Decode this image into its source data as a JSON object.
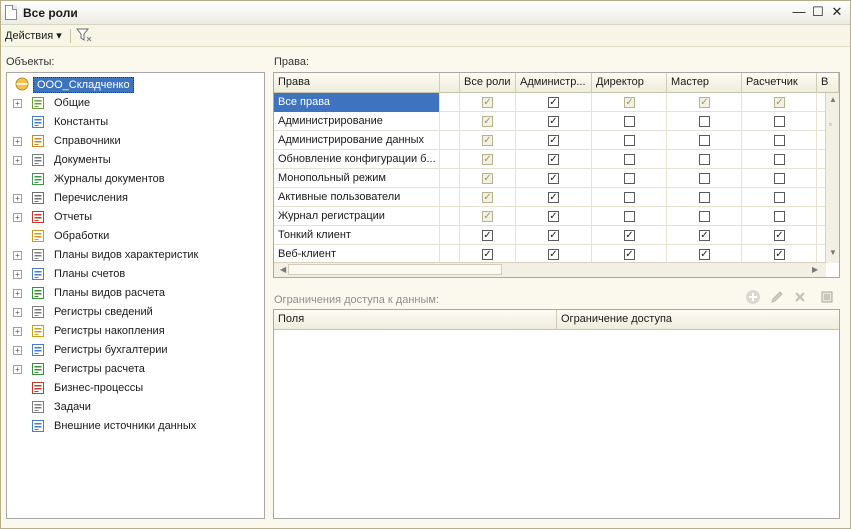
{
  "window": {
    "title": "Все роли",
    "minimize": "—",
    "maximize": "☐",
    "close": "✕"
  },
  "toolbar": {
    "actions_label": "Действия ▾"
  },
  "objects_label": "Объекты:",
  "rights_label": "Права:",
  "restrictions_label": "Ограничения доступа к данным:",
  "tree": {
    "root": "ООО_Складченко",
    "items": [
      {
        "label": "Общие",
        "expandable": true,
        "icon": "common-icon"
      },
      {
        "label": "Константы",
        "expandable": false,
        "icon": "constants-icon"
      },
      {
        "label": "Справочники",
        "expandable": true,
        "icon": "catalogs-icon"
      },
      {
        "label": "Документы",
        "expandable": true,
        "icon": "documents-icon"
      },
      {
        "label": "Журналы документов",
        "expandable": false,
        "icon": "journals-icon"
      },
      {
        "label": "Перечисления",
        "expandable": true,
        "icon": "enums-icon"
      },
      {
        "label": "Отчеты",
        "expandable": true,
        "icon": "reports-icon"
      },
      {
        "label": "Обработки",
        "expandable": false,
        "icon": "processing-icon"
      },
      {
        "label": "Планы видов характеристик",
        "expandable": true,
        "icon": "char-plans-icon"
      },
      {
        "label": "Планы счетов",
        "expandable": true,
        "icon": "accounts-icon"
      },
      {
        "label": "Планы видов расчета",
        "expandable": true,
        "icon": "calc-plans-icon"
      },
      {
        "label": "Регистры сведений",
        "expandable": true,
        "icon": "info-registers-icon"
      },
      {
        "label": "Регистры накопления",
        "expandable": true,
        "icon": "accum-registers-icon"
      },
      {
        "label": "Регистры бухгалтерии",
        "expandable": true,
        "icon": "account-registers-icon"
      },
      {
        "label": "Регистры расчета",
        "expandable": true,
        "icon": "calc-registers-icon"
      },
      {
        "label": "Бизнес-процессы",
        "expandable": false,
        "icon": "business-process-icon"
      },
      {
        "label": "Задачи",
        "expandable": false,
        "icon": "tasks-icon"
      },
      {
        "label": "Внешние источники данных",
        "expandable": false,
        "icon": "external-sources-icon"
      }
    ]
  },
  "rights_grid": {
    "columns": [
      "Права",
      "Все роли",
      "Администр...",
      "Директор",
      "Мастер",
      "Расчетчик",
      "В"
    ],
    "rows": [
      {
        "name": "Все права",
        "values": [
          true,
          true,
          true,
          true,
          true
        ],
        "disabled": [
          true,
          false,
          true,
          true,
          true
        ]
      },
      {
        "name": "Администрирование",
        "values": [
          true,
          true,
          false,
          false,
          false
        ],
        "disabled": [
          true,
          false,
          false,
          false,
          false
        ]
      },
      {
        "name": "Администрирование данных",
        "values": [
          true,
          true,
          false,
          false,
          false
        ],
        "disabled": [
          true,
          false,
          false,
          false,
          false
        ]
      },
      {
        "name": "Обновление конфигурации б...",
        "values": [
          true,
          true,
          false,
          false,
          false
        ],
        "disabled": [
          true,
          false,
          false,
          false,
          false
        ]
      },
      {
        "name": "Монопольный режим",
        "values": [
          true,
          true,
          false,
          false,
          false
        ],
        "disabled": [
          true,
          false,
          false,
          false,
          false
        ]
      },
      {
        "name": "Активные пользователи",
        "values": [
          true,
          true,
          false,
          false,
          false
        ],
        "disabled": [
          true,
          false,
          false,
          false,
          false
        ]
      },
      {
        "name": "Журнал регистрации",
        "values": [
          true,
          true,
          false,
          false,
          false
        ],
        "disabled": [
          true,
          false,
          false,
          false,
          false
        ]
      },
      {
        "name": "Тонкий клиент",
        "values": [
          true,
          true,
          true,
          true,
          true
        ],
        "disabled": [
          false,
          false,
          false,
          false,
          false
        ]
      },
      {
        "name": "Веб-клиент",
        "values": [
          true,
          true,
          true,
          true,
          true
        ],
        "disabled": [
          false,
          false,
          false,
          false,
          false
        ]
      }
    ]
  },
  "restrictions_grid": {
    "columns": [
      "Поля",
      "Ограничение доступа"
    ]
  },
  "colors": {
    "selection": "#3d73bf",
    "panel_bg": "#fbf9ee"
  }
}
